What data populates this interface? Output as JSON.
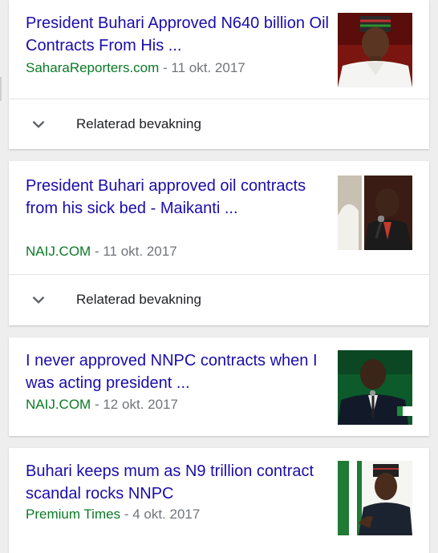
{
  "results": [
    {
      "title": "President Buhari Approved N640 billion Oil Contracts From His ...",
      "source": "SaharaReporters.com",
      "date": "- 11 okt. 2017",
      "thumbnail_icon": "photo-buhari-portrait",
      "related_label": "Relaterad bevakning"
    },
    {
      "title": "President Buhari approved oil contracts from his sick bed - Maikanti ...",
      "source": "NAIJ.COM",
      "date": "- 11 okt. 2017",
      "thumbnail_icon": "photo-speaker-microphone",
      "related_label": "Relaterad bevakning"
    },
    {
      "title": "I never approved NNPC contracts when I was acting president ...",
      "source": "NAIJ.COM",
      "date": "- 12 okt. 2017",
      "thumbnail_icon": "photo-speaker-green-background"
    },
    {
      "title": "Buhari keeps mum as N9 trillion contract scandal rocks NNPC",
      "source": "Premium Times",
      "date": "- 4 okt. 2017",
      "thumbnail_icon": "photo-buhari-speaking"
    }
  ],
  "colors": {
    "title": "#1a0dab",
    "source": "#0b7a26",
    "date": "#70757a",
    "background": "#eeeeee"
  }
}
